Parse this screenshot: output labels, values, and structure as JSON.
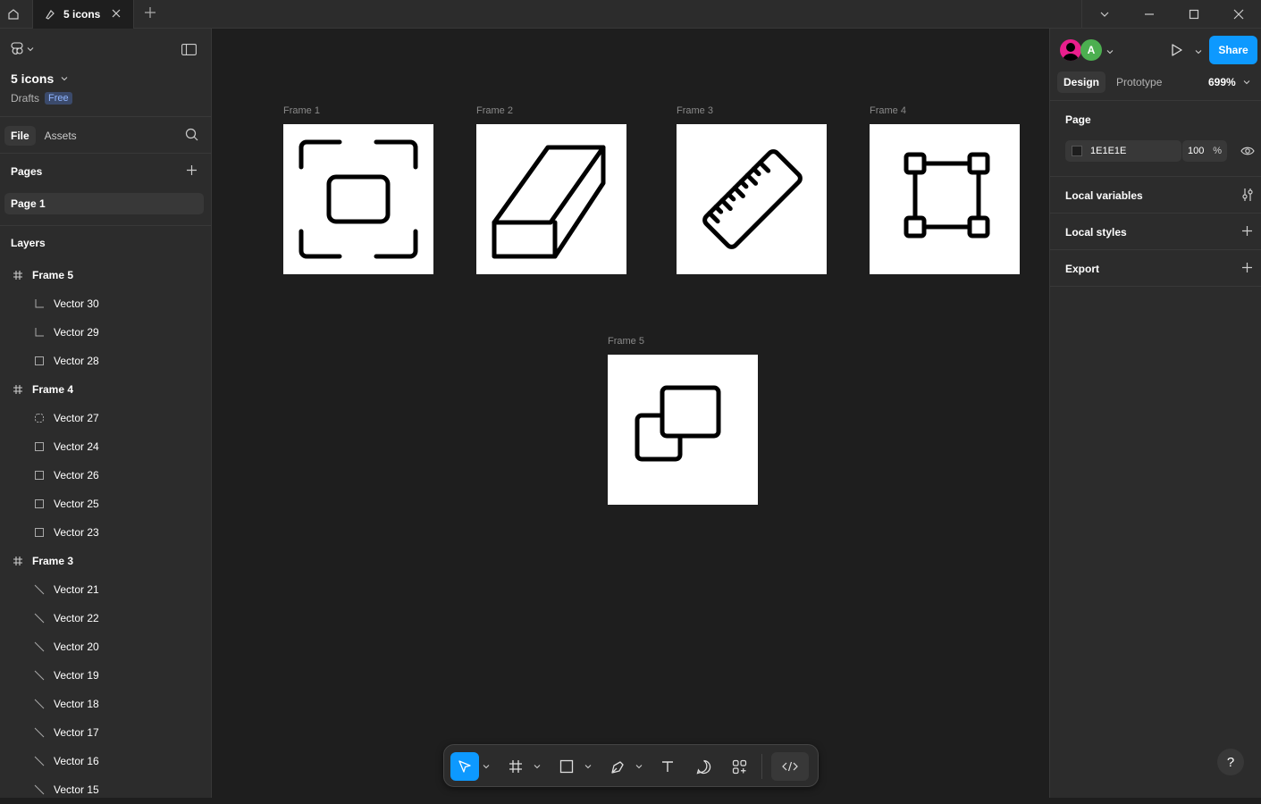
{
  "tabs": {
    "active_title": "5 icons"
  },
  "file": {
    "name": "5 icons",
    "location": "Drafts",
    "plan_badge": "Free"
  },
  "left_nav": {
    "file_tab": "File",
    "assets_tab": "Assets"
  },
  "pages": {
    "heading": "Pages",
    "items": [
      "Page 1"
    ]
  },
  "layers": {
    "heading": "Layers",
    "items": [
      {
        "label": "Frame 5",
        "kind": "frame"
      },
      {
        "label": "Vector 30",
        "kind": "corner"
      },
      {
        "label": "Vector 29",
        "kind": "corner"
      },
      {
        "label": "Vector 28",
        "kind": "rect"
      },
      {
        "label": "Frame 4",
        "kind": "frame"
      },
      {
        "label": "Vector 27",
        "kind": "dashed"
      },
      {
        "label": "Vector 24",
        "kind": "rect"
      },
      {
        "label": "Vector 26",
        "kind": "rect"
      },
      {
        "label": "Vector 25",
        "kind": "rect"
      },
      {
        "label": "Vector 23",
        "kind": "rect"
      },
      {
        "label": "Frame 3",
        "kind": "frame"
      },
      {
        "label": "Vector 21",
        "kind": "line"
      },
      {
        "label": "Vector 22",
        "kind": "line"
      },
      {
        "label": "Vector 20",
        "kind": "line"
      },
      {
        "label": "Vector 19",
        "kind": "line"
      },
      {
        "label": "Vector 18",
        "kind": "line"
      },
      {
        "label": "Vector 17",
        "kind": "line"
      },
      {
        "label": "Vector 16",
        "kind": "line"
      },
      {
        "label": "Vector 15",
        "kind": "line"
      }
    ]
  },
  "canvas": {
    "frames": [
      {
        "label": "Frame 1",
        "icon": "focus-frame-icon"
      },
      {
        "label": "Frame 2",
        "icon": "eraser-icon"
      },
      {
        "label": "Frame 3",
        "icon": "ruler-icon"
      },
      {
        "label": "Frame 4",
        "icon": "vector-square-icon"
      },
      {
        "label": "Frame 5",
        "icon": "copy-squares-icon"
      }
    ]
  },
  "right_panel": {
    "avatar_initial": "A",
    "share_label": "Share",
    "design_tab": "Design",
    "prototype_tab": "Prototype",
    "zoom": "699%",
    "page_heading": "Page",
    "page_color_hex": "1E1E1E",
    "page_opacity": "100",
    "percent_sign": "%",
    "sections": [
      "Local variables",
      "Local styles",
      "Export"
    ]
  },
  "help_label": "?",
  "colors": {
    "accent": "#0d99ff",
    "panel": "#2c2c2c",
    "canvas": "#1e1e1e",
    "avatar_green": "#4caf50",
    "avatar_pink": "#e91e8c"
  }
}
